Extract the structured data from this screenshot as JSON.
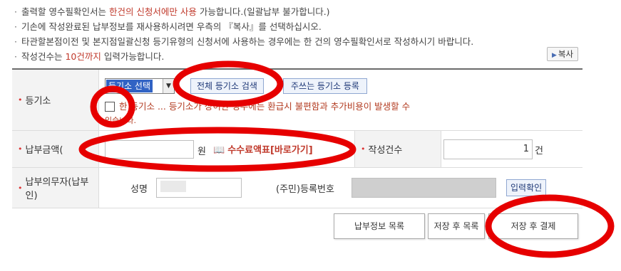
{
  "notices": [
    {
      "segments": [
        {
          "text": "출력할 영수필확인서는 ",
          "hl": false
        },
        {
          "text": "한건의 신청서에만 사용",
          "hl": true
        },
        {
          "text": " 가능합니다.(일괄납부 불가합니다.)",
          "hl": false
        }
      ]
    },
    {
      "segments": [
        {
          "text": "기손에 작성완료된 납부정보를 재사용하시려면 우측의 『복사』를 선택하십시오.",
          "hl": false
        }
      ]
    },
    {
      "segments": [
        {
          "text": "타관할본점이전 및 본지점일괄신청 등기유형의 신청서에 사용하는 경우에는 한 건의 영수필확인서로 작성하시기 바랍니다.",
          "hl": false
        }
      ]
    },
    {
      "segments": [
        {
          "text": "작성건수는 ",
          "hl": false
        },
        {
          "text": "10건까지",
          "hl": true
        },
        {
          "text": " 입력가능합니다.",
          "hl": false
        }
      ]
    }
  ],
  "copy_button": "복사",
  "registry": {
    "label": "등기소",
    "select_value": "등기소 선택",
    "lookup_button": "전체 등기소 검색",
    "register_button": "주쓰는 등기소 등록",
    "warning": "한 등기소 ... 등기소가 상이한 경우에는 환급시 불편함과 추가비용이 발생할 수",
    "warning2": "있습니다."
  },
  "payment": {
    "label": "납부금액(",
    "amount_value": "",
    "unit": "원",
    "fee_link": "수수료액표[바로가기]",
    "count_label": "작성건수",
    "count_value": "1",
    "count_unit": "건"
  },
  "payer": {
    "label": "납부의무자(납부인)",
    "name_label": "성명",
    "reg_label": "(주민)등록번호",
    "confirm_button": "입력확인"
  },
  "actions": {
    "list": "납부정보 목록",
    "save_list": "저장 후 목록",
    "save_pay": "저장 후 결제"
  },
  "colors": {
    "highlight": "#c0392b",
    "annotation": "#e60000",
    "header_bg": "#f3f3f3"
  }
}
